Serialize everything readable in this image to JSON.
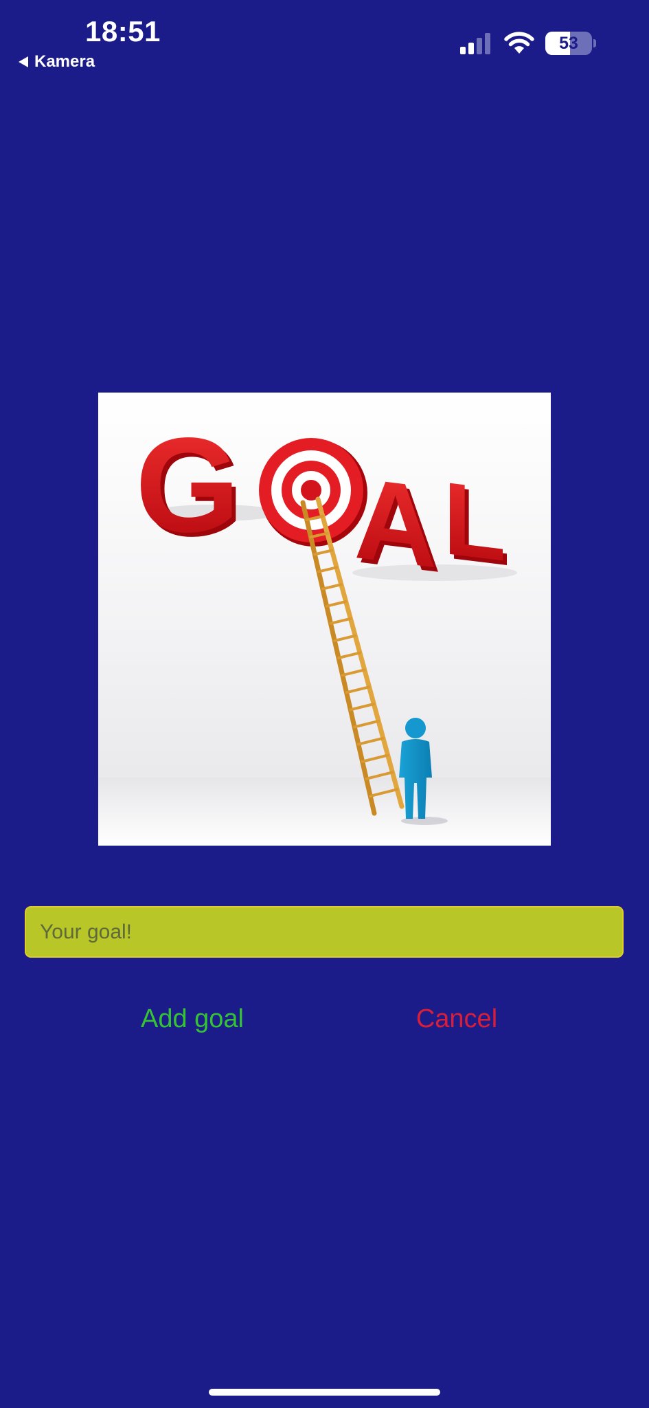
{
  "status_bar": {
    "time": "18:51",
    "back_label": "Kamera",
    "battery_level": "53",
    "battery_fraction": 0.53,
    "icons": [
      "back-arrow-icon",
      "cellular-signal-icon",
      "wifi-icon",
      "battery-icon"
    ]
  },
  "goal_image": {
    "word": "GOAL",
    "icon": "goal-target-ladder-illustration"
  },
  "form": {
    "input_placeholder": "Your goal!",
    "input_value": "",
    "add_label": "Add goal",
    "cancel_label": "Cancel"
  },
  "colors": {
    "background": "#1b1c8a",
    "input_background": "#b8c628",
    "input_border": "#e0cd2a",
    "add_button": "#35c335",
    "cancel_button": "#d81f3a"
  }
}
